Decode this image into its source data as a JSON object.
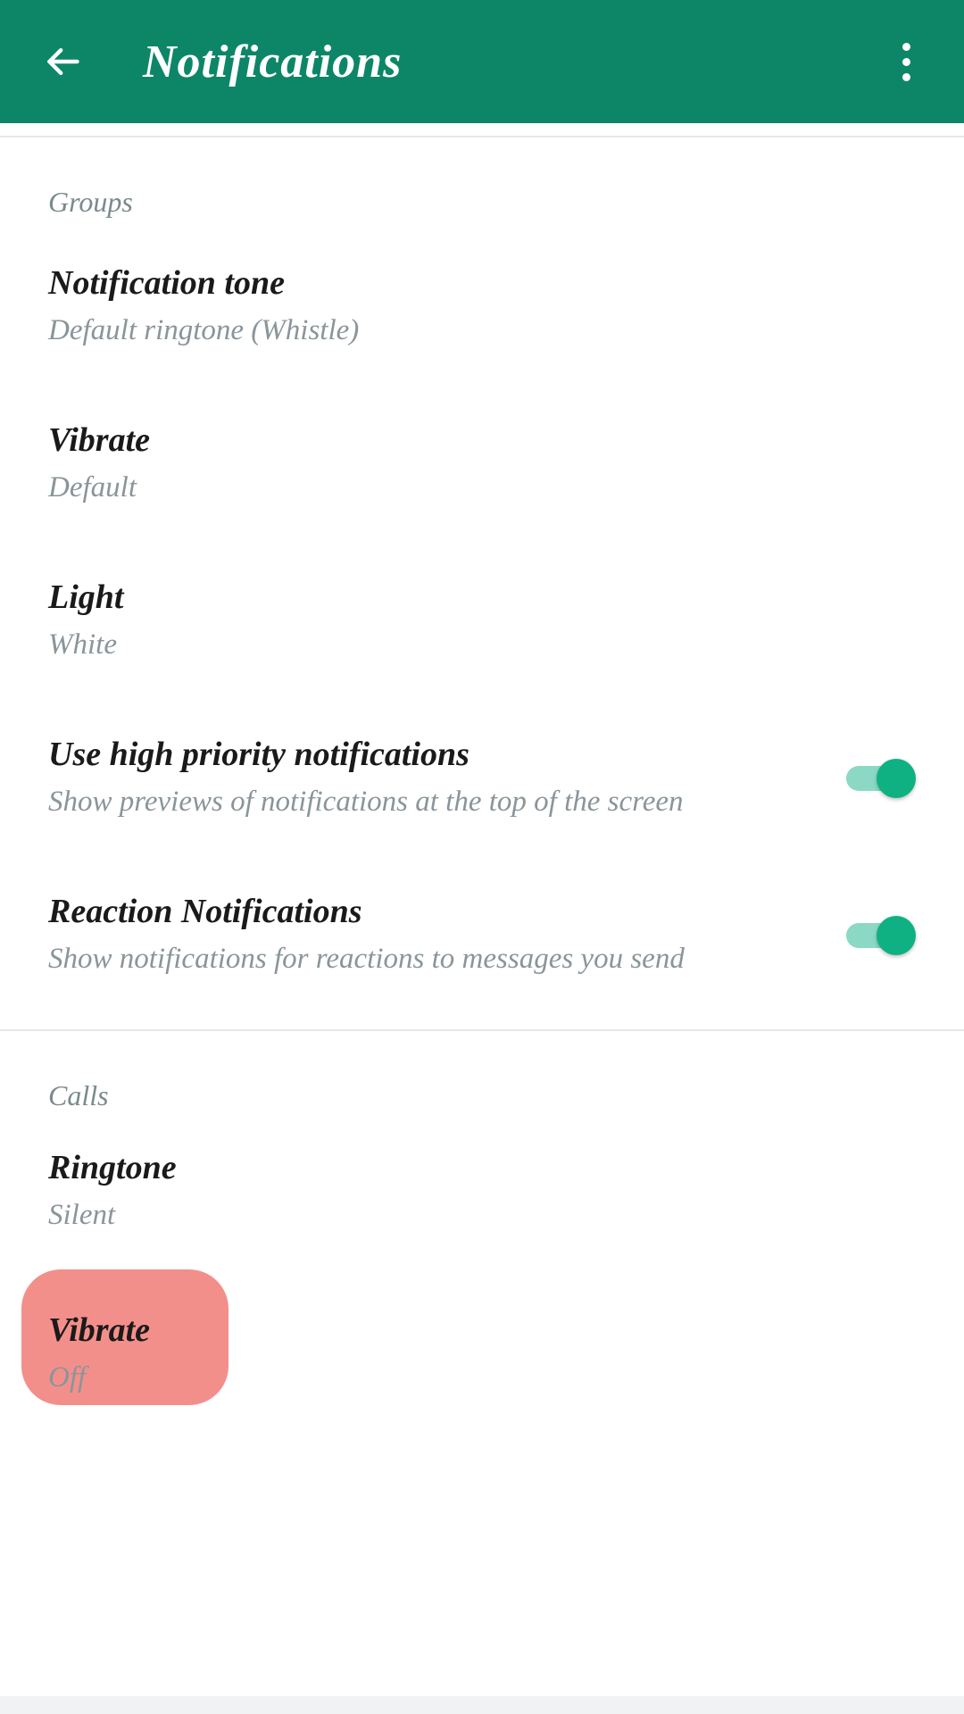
{
  "header": {
    "title": "Notifications"
  },
  "sections": {
    "groups": {
      "label": "Groups",
      "notification_tone": {
        "title": "Notification tone",
        "value": "Default ringtone (Whistle)"
      },
      "vibrate": {
        "title": "Vibrate",
        "value": "Default"
      },
      "light": {
        "title": "Light",
        "value": "White"
      },
      "high_priority": {
        "title": "Use high priority notifications",
        "desc": "Show previews of notifications at the top of the screen",
        "on": true
      },
      "reaction": {
        "title": "Reaction Notifications",
        "desc": "Show notifications for reactions to messages you send",
        "on": true
      }
    },
    "calls": {
      "label": "Calls",
      "ringtone": {
        "title": "Ringtone",
        "value": "Silent"
      },
      "vibrate": {
        "title": "Vibrate",
        "value": "Off"
      }
    }
  },
  "colors": {
    "accent": "#0d8668",
    "switch_on": "#0fb183",
    "highlight": "#f38f8a"
  }
}
